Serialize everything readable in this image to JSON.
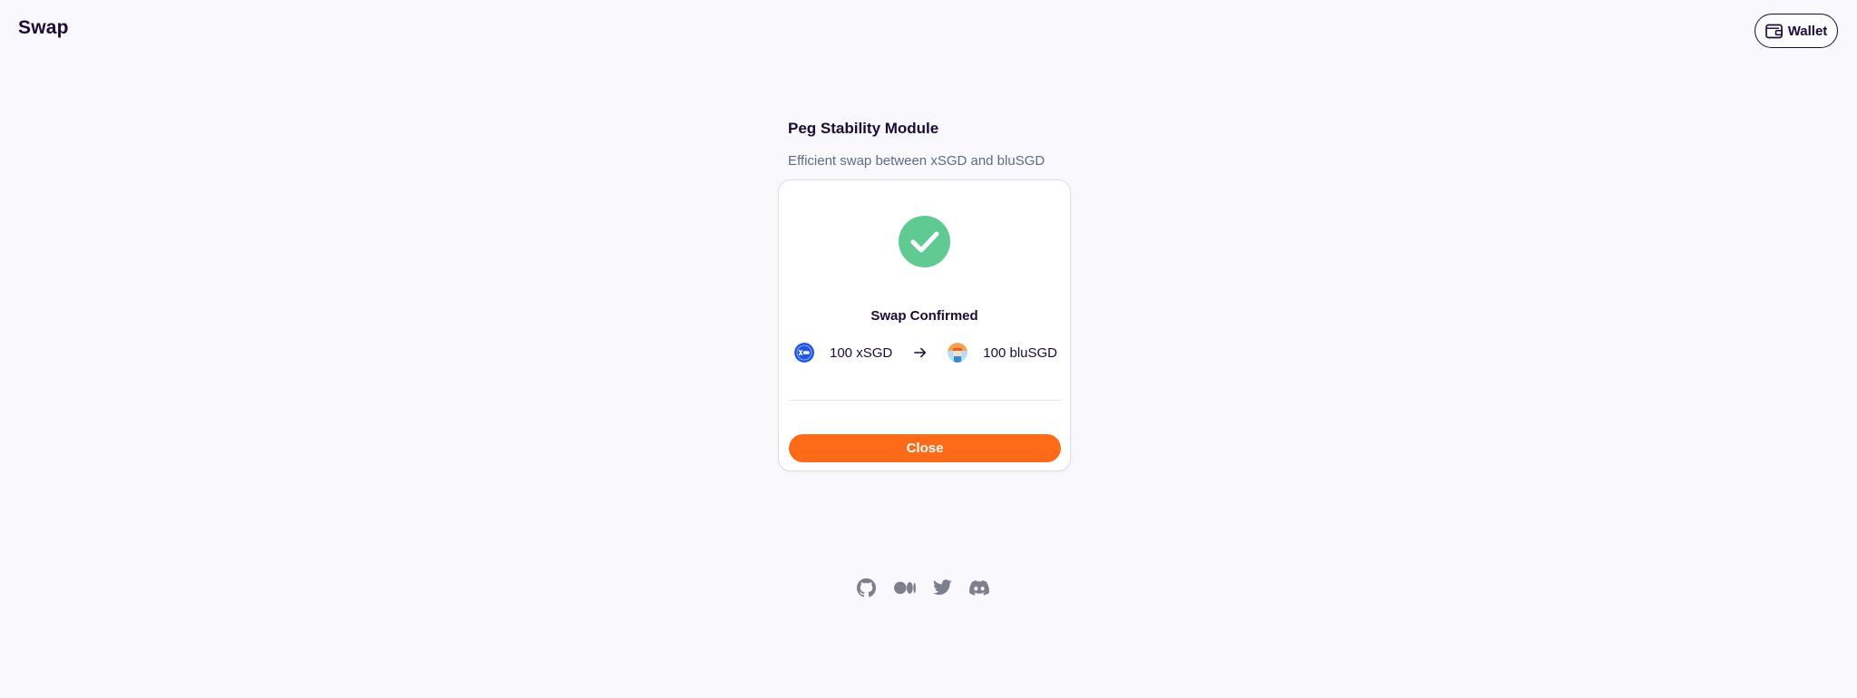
{
  "header": {
    "title": "Swap",
    "wallet_label": "Wallet"
  },
  "panel": {
    "title": "Peg Stability Module",
    "subtitle": "Efficient swap between xSGD and bluSGD"
  },
  "confirmation": {
    "title": "Swap Confirmed",
    "from": {
      "amount": "100 xSGD",
      "icon": "xsgd-token-icon"
    },
    "to": {
      "amount": "100 bluSGD",
      "icon": "blusgd-token-icon"
    },
    "close_label": "Close"
  },
  "footer": {
    "icons": [
      "github-icon",
      "medium-icon",
      "twitter-icon",
      "discord-icon"
    ]
  },
  "colors": {
    "background": "#f9f9fd",
    "text": "#1c0b36",
    "accent": "#fd6b18",
    "success": "#5fcb93",
    "muted": "#5f6b84"
  }
}
